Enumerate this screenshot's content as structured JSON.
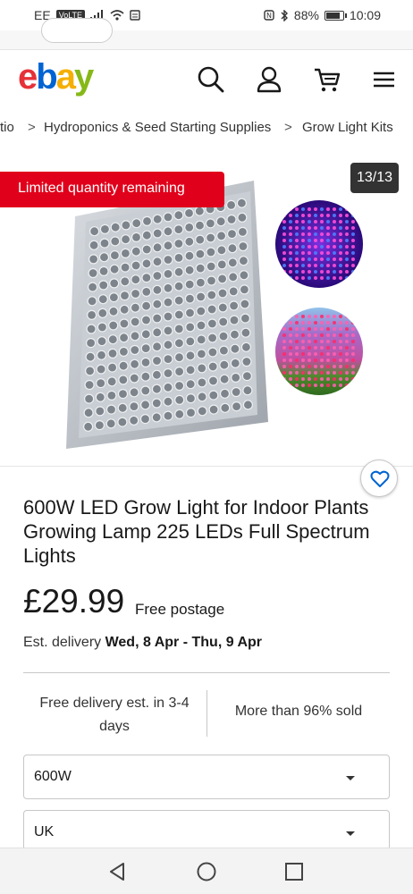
{
  "status_bar": {
    "carrier": "EE",
    "volte": "VoLTE",
    "battery_percent": "88%",
    "battery_level": 0.88,
    "time": "10:09"
  },
  "header": {
    "logo": {
      "e": "e",
      "b": "b",
      "a": "a",
      "y": "y"
    },
    "icons": [
      "search-icon",
      "account-icon",
      "cart-icon",
      "menu-icon"
    ]
  },
  "breadcrumb": {
    "items": [
      "tio",
      "Hydroponics & Seed Starting Supplies",
      "Grow Light Kits"
    ],
    "separator": ">"
  },
  "gallery": {
    "badge": "Limited quantity remaining",
    "counter": "13/13"
  },
  "product": {
    "title": "600W LED Grow Light for Indoor Plants Growing Lamp 225 LEDs Full Spectrum Lights",
    "price": "£29.99",
    "postage": "Free postage",
    "delivery_label": "Est. delivery",
    "delivery_dates": "Wed, 8 Apr - Thu, 9 Apr"
  },
  "stats": {
    "delivery_estimate": "Free delivery est. in 3-4 days",
    "sold": "More than 96% sold"
  },
  "selects": {
    "wattage": "600W",
    "plug": "UK"
  },
  "colors": {
    "badge_red": "#e0001b",
    "ebay_red": "#e53238",
    "ebay_blue": "#0064d2",
    "ebay_yellow": "#f5af02",
    "ebay_green": "#86b817",
    "wishlist_blue": "#0064d2"
  }
}
